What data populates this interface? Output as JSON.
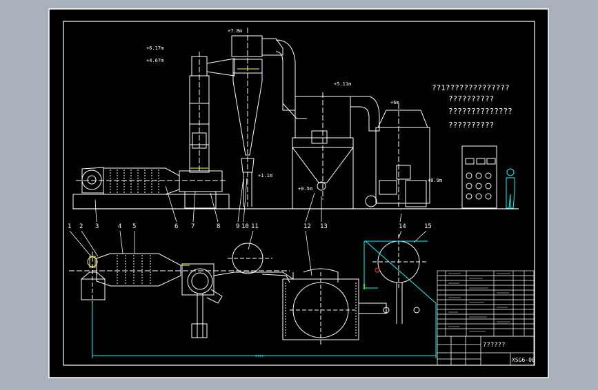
{
  "colors": {
    "background": "#a9b1bd",
    "sheet": "#000000",
    "line": "#ffffff",
    "accent_yellow": "#ffff00",
    "accent_cyan": "#00ffff",
    "accent_green": "#00ff00",
    "accent_red": "#ff3030"
  },
  "elevations": {
    "e1": "+6.17m",
    "e2": "+4.67m",
    "e3": "+7.8m",
    "e4": "+5.11m",
    "e5": "+6m",
    "e6": "+1.1m",
    "e7": "+0.5m",
    "e8": "+0.9m"
  },
  "part_numbers": [
    "1",
    "2",
    "3",
    "4",
    "5",
    "6",
    "7",
    "8",
    "9",
    "10",
    "11",
    "12",
    "13",
    "14",
    "15"
  ],
  "notes": [
    "??1??????????????",
    "??????????",
    "??????????????",
    "??????????"
  ],
  "dimension_label": "????",
  "title_block": {
    "title": "??????",
    "drawing_no": "XSG6-00"
  }
}
